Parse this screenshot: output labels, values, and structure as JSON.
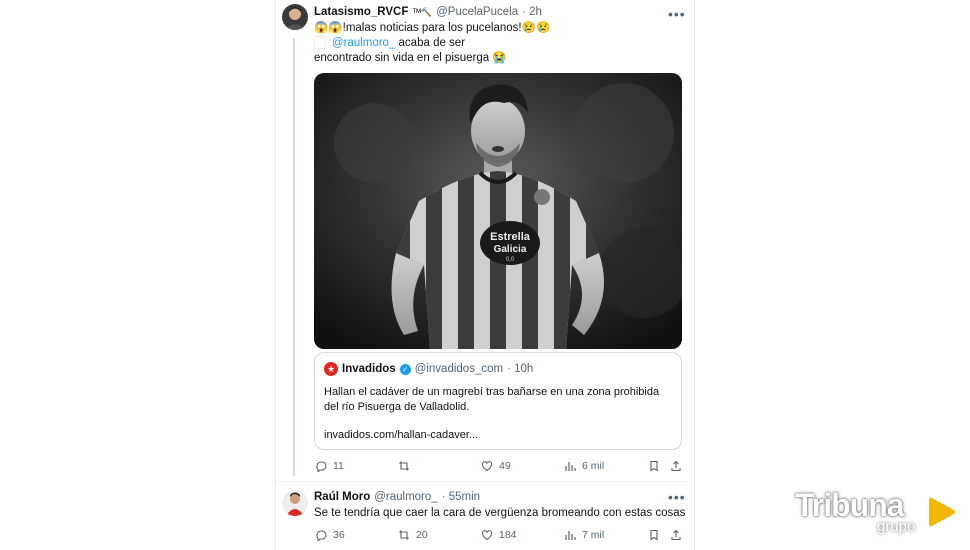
{
  "tweet1": {
    "name": "Latasismo_RVCF",
    "name_suffix": "ᵀᴹ🔨",
    "handle": "@PucelaPucela",
    "time": "· 2h",
    "line1": "😱😱!malas noticias para los pucelanos!😢😢",
    "line2_prefix": "🏻 :",
    "mention": "@raulmoro_",
    "line2_suffix": " acaba de ser",
    "line3": "encontrado sin vida en el pisuerga 😭",
    "more_icon": "more-dots-icon",
    "image_sponsor_top": "Estrella",
    "image_sponsor_bottom": "Galicia",
    "image_sponsor_sub": "0,0",
    "quote": {
      "name": "Invadidos",
      "handle": "@invadidos_com",
      "time": "· 10h",
      "text": "Hallan el cadáver de un magrebí tras bañarse en una zona prohibida del río Pisuerga de Valladolid.",
      "link": "invadidos.com/hallan-cadaver..."
    },
    "actions": {
      "replies": "11",
      "retweets": "",
      "likes": "49",
      "views": "6 mil"
    }
  },
  "tweet2": {
    "name": "Raúl Moro",
    "handle": "@raulmoro_",
    "time": "· 55min",
    "text": "Se te tendría que caer la cara de vergüenza bromeando con estas cosas",
    "actions": {
      "replies": "36",
      "retweets": "20",
      "likes": "184",
      "views": "7 mil"
    }
  },
  "watermark": {
    "brand": "Tribuna",
    "sub": "grupo"
  },
  "colors": {
    "link": "#1d9bf0",
    "secondary": "#536471",
    "border": "#cfd9de",
    "brand": "#f2b705",
    "badge": "#1d9bf0"
  }
}
